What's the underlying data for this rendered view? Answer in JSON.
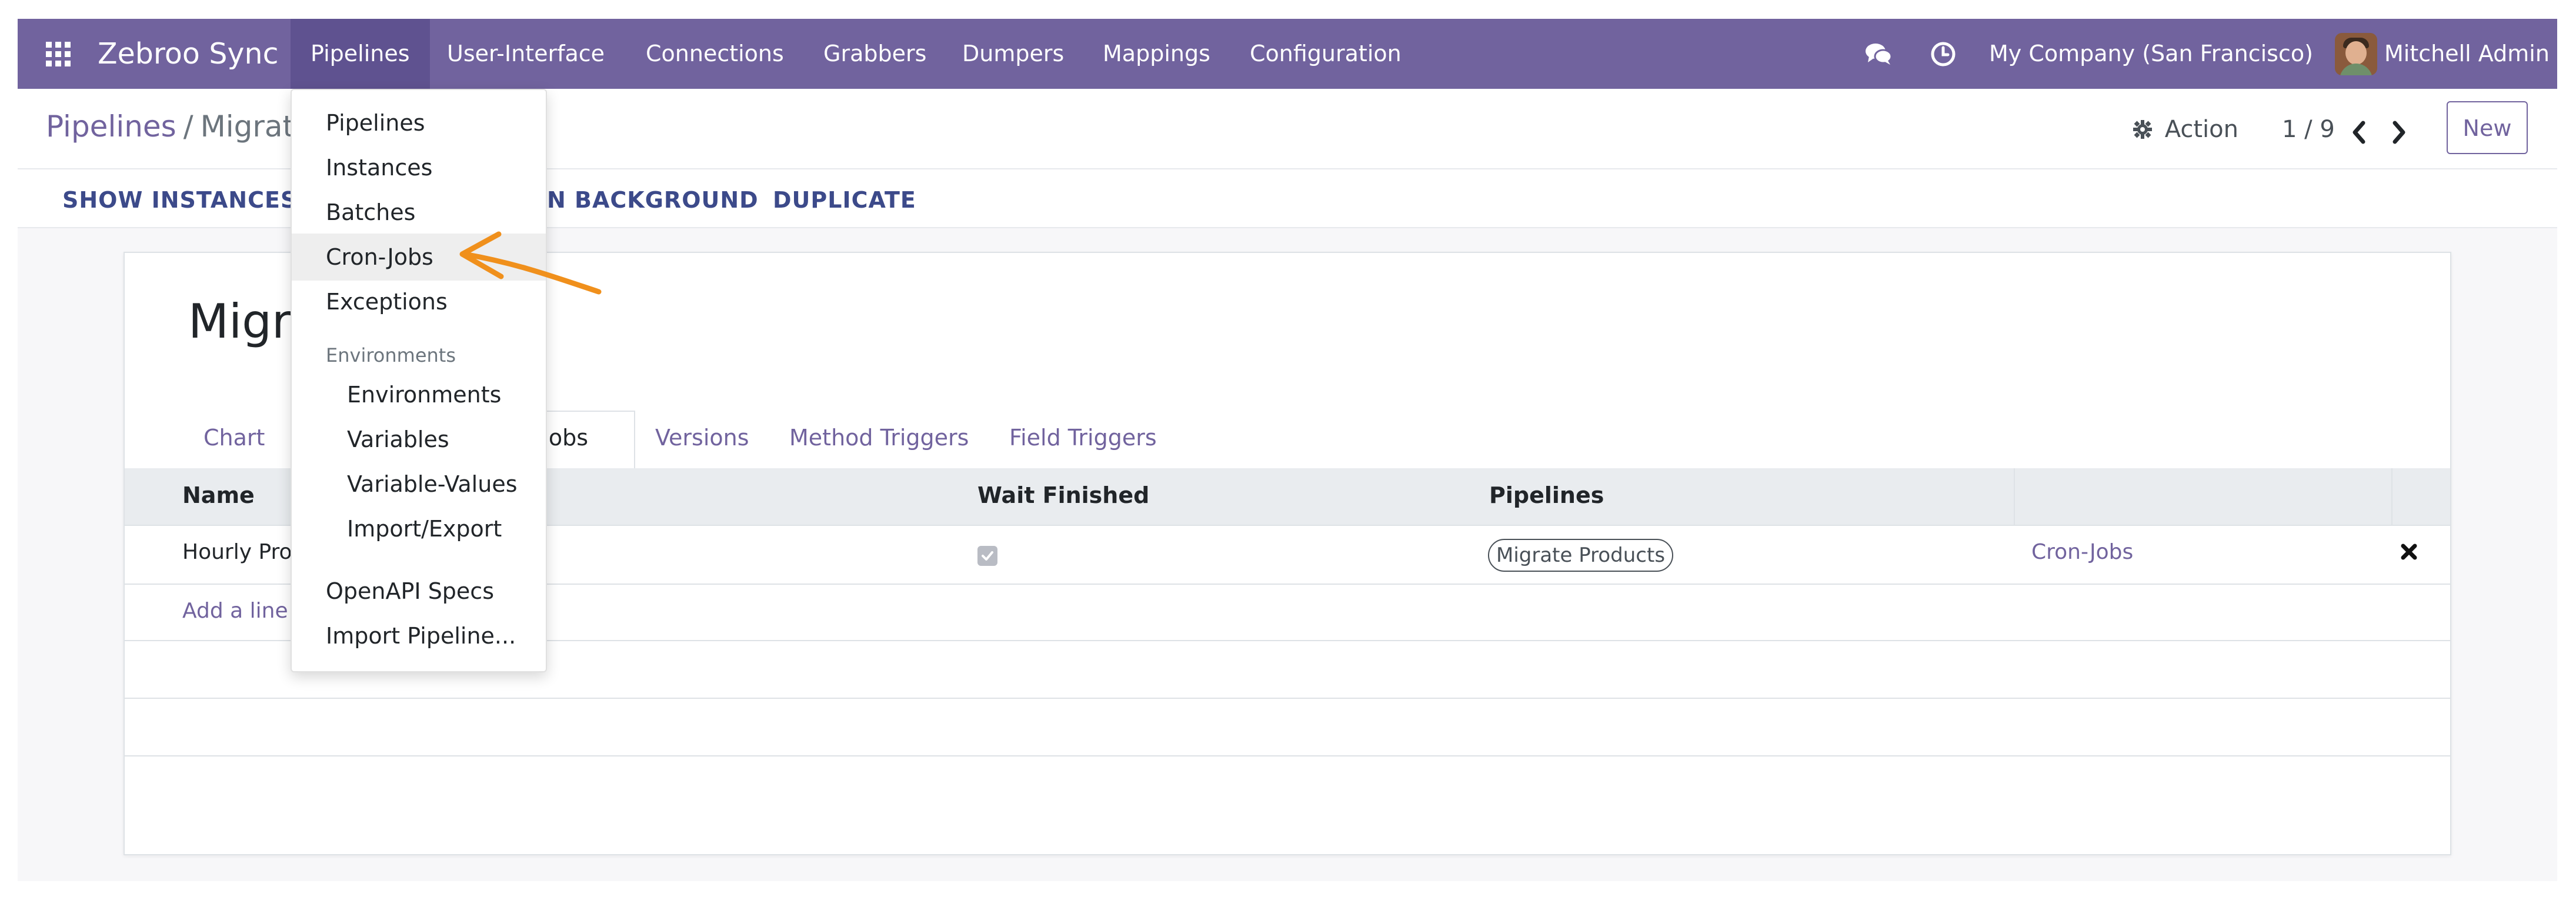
{
  "navbar": {
    "brand": "Zebroo Sync",
    "menus": [
      "Pipelines",
      "User-Interface",
      "Connections",
      "Grabbers",
      "Dumpers",
      "Mappings",
      "Configuration"
    ],
    "company": "My Company (San Francisco)",
    "user": "Mitchell Admin",
    "icons": [
      "apps-grid-icon",
      "chat-bubbles-icon",
      "clock-icon"
    ],
    "color": "#71639e"
  },
  "breadcrumb": {
    "parent": "Pipelines",
    "separator": "/",
    "current": "Migrat"
  },
  "control": {
    "action_label": "Action",
    "pager": "1 / 9",
    "new_label": "New"
  },
  "statusbar": {
    "show_instances": "SHOW INSTANCES",
    "run_background": "N BACKGROUND",
    "duplicate": "DUPLICATE"
  },
  "record": {
    "title": "Migra"
  },
  "tabs": {
    "chart": "Chart",
    "cronjobs_partial": "onjobs",
    "versions": "Versions",
    "method_triggers": "Method Triggers",
    "field_triggers": "Field Triggers"
  },
  "table": {
    "headers": {
      "name": "Name",
      "wait_finished": "Wait Finished",
      "pipelines": "Pipelines"
    },
    "rows": [
      {
        "name": "Hourly Pro",
        "wait_finished": true,
        "pipeline_tag": "Migrate Products",
        "link": "Cron-Jobs"
      }
    ],
    "add_line": "Add a line"
  },
  "dropdown": {
    "items": [
      "Pipelines",
      "Instances",
      "Batches",
      "Cron-Jobs",
      "Exceptions"
    ],
    "highlighted": "Cron-Jobs",
    "section_header": "Environments",
    "sub_items": [
      "Environments",
      "Variables",
      "Variable-Values",
      "Import/Export"
    ],
    "bottom_items": [
      "OpenAPI Specs",
      "Import Pipeline..."
    ]
  },
  "annotation_color": "#f0901c"
}
